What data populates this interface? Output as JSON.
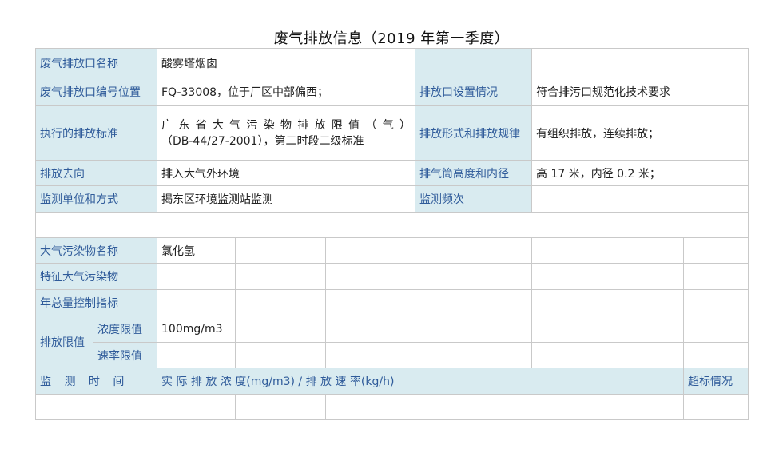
{
  "title": "废气排放信息（2019 年第一季度）",
  "info_rows": {
    "outlet_name_label": "废气排放口名称",
    "outlet_name_value": "酸雾塔烟囱",
    "outlet_code_label": "废气排放口编号位置",
    "outlet_code_value": "FQ-33008，位于厂区中部偏西；",
    "outlet_setup_label": "排放口设置情况",
    "outlet_setup_value": "符合排污口规范化技术要求",
    "standard_label": "执行的排放标准",
    "standard_value_line1": "广东省大气污染物排放限值（气）",
    "standard_value_line2": "（DB-44/27-2001），第二时段二级标准",
    "emission_form_label": "排放形式和排放规律",
    "emission_form_value": "有组织排放，连续排放；",
    "destination_label": "排放去向",
    "destination_value": "排入大气外环境",
    "stack_label": "排气筒高度和内径",
    "stack_value": "高 17 米，内径 0.2 米；",
    "monitor_unit_label": "监测单位和方式",
    "monitor_unit_value": "揭东区环境监测站监测",
    "monitor_freq_label": "监测频次",
    "monitor_freq_value": ""
  },
  "pollutant_rows": {
    "pollutant_name_label": "大气污染物名称",
    "pollutant_name_value": "氯化氢",
    "characteristic_label": "特征大气污染物",
    "annual_total_label": "年总量控制指标",
    "emission_limit_label": "排放限值",
    "concentration_limit_label": "浓度限值",
    "concentration_limit_value": "100mg/m3",
    "rate_limit_label": "速率限值"
  },
  "monitor_header": {
    "time_label": "监 测 时 间",
    "actual_label": "实 际 排 放 浓 度(mg/m3) / 排 放 速 率(kg/h)",
    "exceed_label": "超标情况"
  }
}
